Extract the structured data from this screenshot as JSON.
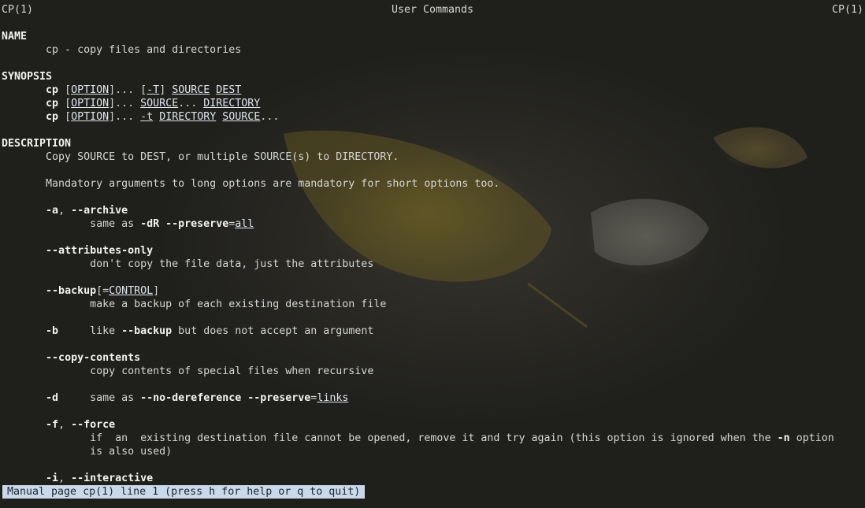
{
  "header": {
    "left": "CP(1)",
    "center": "User Commands",
    "right": "CP(1)"
  },
  "lines": [
    [],
    [
      [
        "NAME",
        "b"
      ]
    ],
    [
      [
        "       cp - copy files and directories",
        "n"
      ]
    ],
    [],
    [
      [
        "SYNOPSIS",
        "b"
      ]
    ],
    [
      [
        "       ",
        "n"
      ],
      [
        "cp",
        "b"
      ],
      [
        " [",
        "n"
      ],
      [
        "OPTION",
        "u"
      ],
      [
        "]... [",
        "n"
      ],
      [
        "-T",
        "u"
      ],
      [
        "] ",
        "n"
      ],
      [
        "SOURCE",
        "u"
      ],
      [
        " ",
        "n"
      ],
      [
        "DEST",
        "u"
      ]
    ],
    [
      [
        "       ",
        "n"
      ],
      [
        "cp",
        "b"
      ],
      [
        " [",
        "n"
      ],
      [
        "OPTION",
        "u"
      ],
      [
        "]... ",
        "n"
      ],
      [
        "SOURCE",
        "u"
      ],
      [
        "... ",
        "n"
      ],
      [
        "DIRECTORY",
        "u"
      ]
    ],
    [
      [
        "       ",
        "n"
      ],
      [
        "cp",
        "b"
      ],
      [
        " [",
        "n"
      ],
      [
        "OPTION",
        "u"
      ],
      [
        "]... ",
        "n"
      ],
      [
        "-t",
        "u"
      ],
      [
        " ",
        "n"
      ],
      [
        "DIRECTORY",
        "u"
      ],
      [
        " ",
        "n"
      ],
      [
        "SOURCE",
        "u"
      ],
      [
        "...",
        "n"
      ]
    ],
    [],
    [
      [
        "DESCRIPTION",
        "b"
      ]
    ],
    [
      [
        "       Copy SOURCE to DEST, or multiple SOURCE(s) to DIRECTORY.",
        "n"
      ]
    ],
    [],
    [
      [
        "       Mandatory arguments to long options are mandatory for short options too.",
        "n"
      ]
    ],
    [],
    [
      [
        "       ",
        "n"
      ],
      [
        "-a",
        "b"
      ],
      [
        ", ",
        "n"
      ],
      [
        "--archive",
        "b"
      ]
    ],
    [
      [
        "              same as ",
        "n"
      ],
      [
        "-dR --preserve",
        "b"
      ],
      [
        "=",
        "n"
      ],
      [
        "all",
        "u"
      ]
    ],
    [],
    [
      [
        "       ",
        "n"
      ],
      [
        "--attributes-only",
        "b"
      ]
    ],
    [
      [
        "              don't copy the file data, just the attributes",
        "n"
      ]
    ],
    [],
    [
      [
        "       ",
        "n"
      ],
      [
        "--backup",
        "b"
      ],
      [
        "[=",
        "n"
      ],
      [
        "CONTROL",
        "u"
      ],
      [
        "]",
        "n"
      ]
    ],
    [
      [
        "              make a backup of each existing destination file",
        "n"
      ]
    ],
    [],
    [
      [
        "       ",
        "n"
      ],
      [
        "-b",
        "b"
      ],
      [
        "     like ",
        "n"
      ],
      [
        "--backup",
        "b"
      ],
      [
        " but does not accept an argument",
        "n"
      ]
    ],
    [],
    [
      [
        "       ",
        "n"
      ],
      [
        "--copy-contents",
        "b"
      ]
    ],
    [
      [
        "              copy contents of special files when recursive",
        "n"
      ]
    ],
    [],
    [
      [
        "       ",
        "n"
      ],
      [
        "-d",
        "b"
      ],
      [
        "     same as ",
        "n"
      ],
      [
        "--no-dereference --preserve",
        "b"
      ],
      [
        "=",
        "n"
      ],
      [
        "links",
        "u"
      ]
    ],
    [],
    [
      [
        "       ",
        "n"
      ],
      [
        "-f",
        "b"
      ],
      [
        ", ",
        "n"
      ],
      [
        "--force",
        "b"
      ]
    ],
    [
      [
        "              if  an  existing destination file cannot be opened, remove it and try again (this option is ignored when the ",
        "n"
      ],
      [
        "-n",
        "b"
      ],
      [
        " option",
        "n"
      ]
    ],
    [
      [
        "              is also used)",
        "n"
      ]
    ],
    [],
    [
      [
        "       ",
        "n"
      ],
      [
        "-i",
        "b"
      ],
      [
        ", ",
        "n"
      ],
      [
        "--interactive",
        "b"
      ]
    ]
  ],
  "status": "Manual page cp(1) line 1 (press h for help or q to quit)"
}
